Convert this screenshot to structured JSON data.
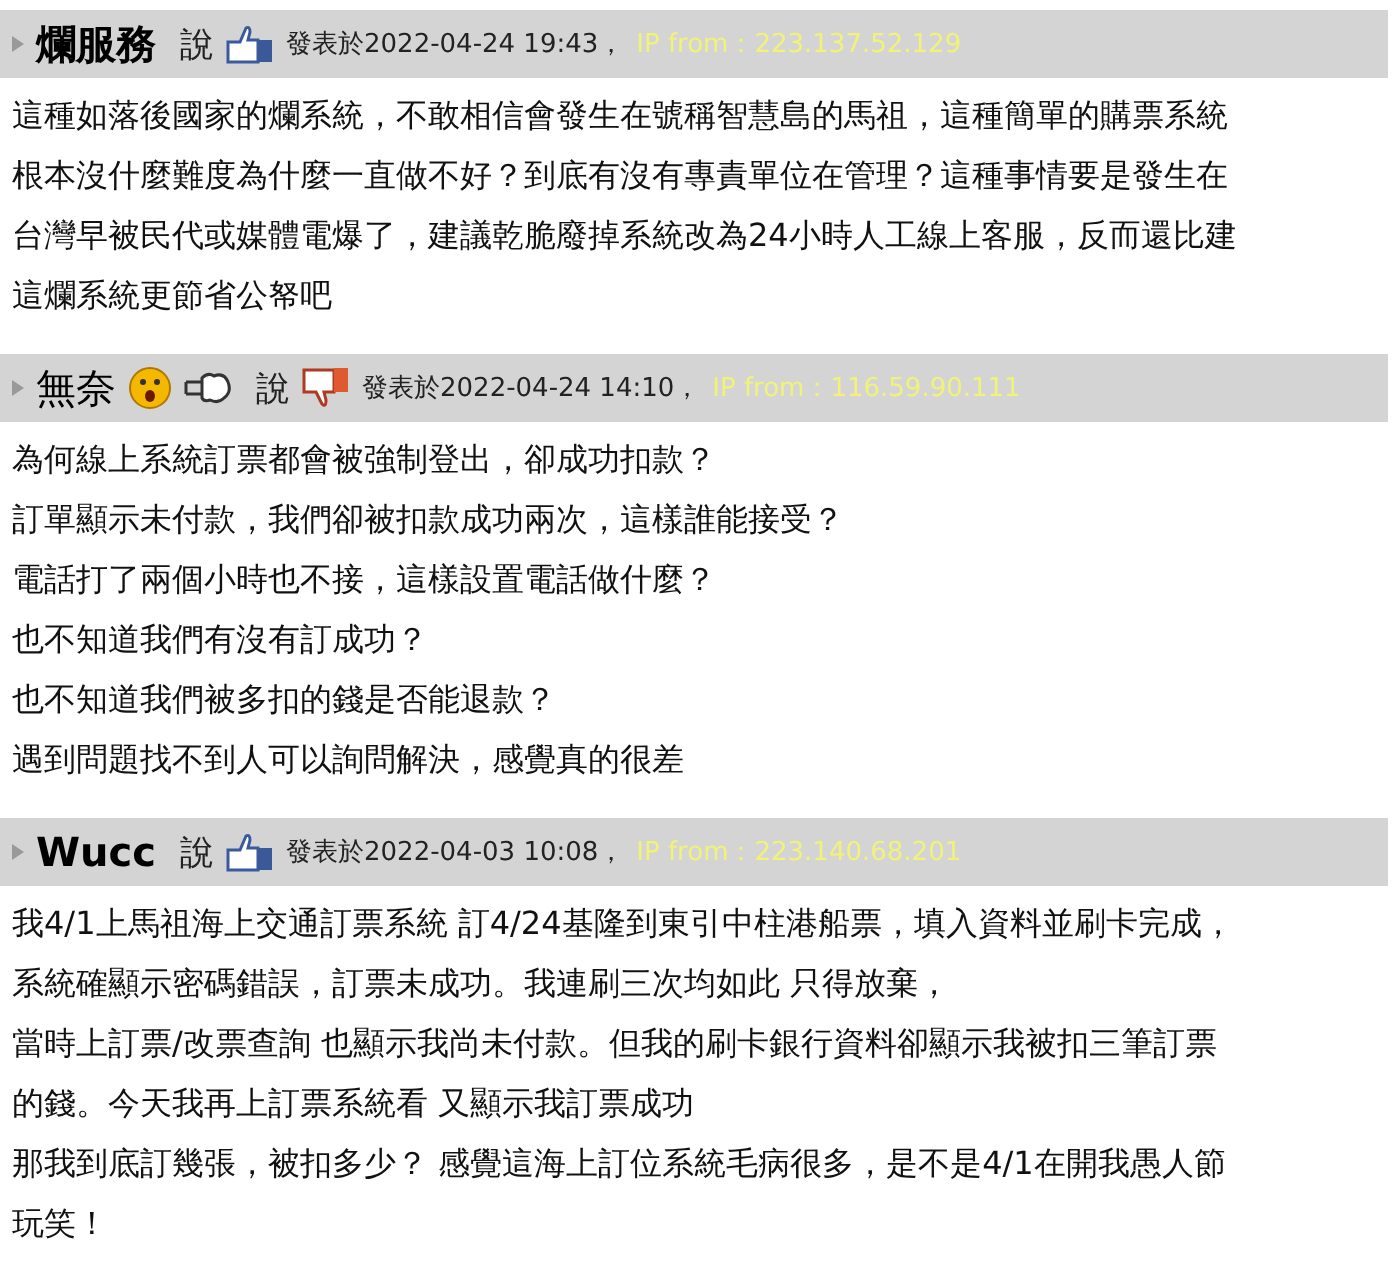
{
  "comments": [
    {
      "author": "爛服務",
      "author_bold": true,
      "said": "說",
      "vote": {
        "kind": "up"
      },
      "date": "發表於2022-04-24 19:43，",
      "ip": "IP from：223.137.52.129",
      "lines": [
        "這種如落後國家的爛系統，不敢相信會發生在號稱智慧島的馬祖，這種簡單的購票系統",
        "根本沒什麼難度為什麼一直做不好？到底有沒有專責單位在管理？這種事情要是發生在",
        "台灣早被民代或媒體電爆了，建議乾脆廢掉系統改為24小時人工線上客服，反而還比建",
        "這爛系統更節省公帑吧"
      ]
    },
    {
      "author": "無奈",
      "author_bold": false,
      "emojis": [
        {
          "kind": "surprised"
        },
        {
          "kind": "puff"
        }
      ],
      "said": "說",
      "vote": {
        "kind": "down"
      },
      "date": "發表於2022-04-24 14:10，",
      "ip": "IP from：116.59.90.111",
      "lines": [
        "為何線上系統訂票都會被強制登出，卻成功扣款？",
        "訂單顯示未付款，我們卻被扣款成功兩次，這樣誰能接受？",
        "電話打了兩個小時也不接，這樣設置電話做什麼？",
        "也不知道我們有沒有訂成功？",
        "也不知道我們被多扣的錢是否能退款？",
        "遇到問題找不到人可以詢問解決，感覺真的很差"
      ]
    },
    {
      "author": "Wucc",
      "author_bold": true,
      "said": "說",
      "vote": {
        "kind": "up"
      },
      "date": "發表於2022-04-03 10:08，",
      "ip": "IP from：223.140.68.201",
      "lines": [
        "我4/1上馬祖海上交通訂票系統 訂4/24基隆到東引中柱港船票，填入資料並刷卡完成，",
        "系統確顯示密碼錯誤，訂票未成功。我連刷三次均如此 只得放棄，",
        "當時上訂票/改票查詢 也顯示我尚未付款。但我的刷卡銀行資料卻顯示我被扣三筆訂票",
        "的錢。今天我再上訂票系統看 又顯示我訂票成功",
        "那我到底訂幾張，被扣多少？ 感覺這海上訂位系統毛病很多，是不是4/1在開我愚人節",
        "玩笑！"
      ]
    }
  ]
}
